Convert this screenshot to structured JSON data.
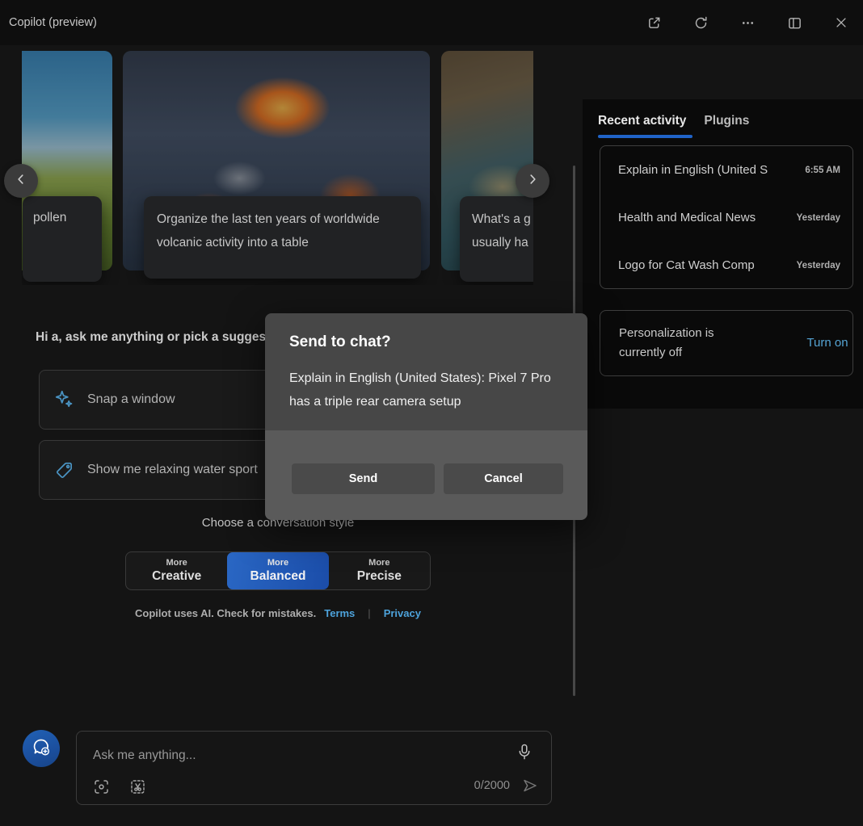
{
  "titlebar": {
    "title": "Copilot (preview)"
  },
  "carousel": {
    "cards": [
      {
        "label": "pollen"
      },
      {
        "label": "Organize the last ten years of worldwide volcanic activity into a table"
      },
      {
        "label_line1": "What's a g",
        "label_line2": "usually ha"
      }
    ]
  },
  "chat": {
    "greeting": "Hi a, ask me anything or pick a suggestion",
    "suggestions": [
      {
        "label": "Snap a window",
        "icon": "sparkle-icon"
      },
      {
        "label": "Show me relaxing water sport",
        "icon": "tag-icon"
      }
    ],
    "style_picker": {
      "caption": "Choose a conversation style",
      "options": [
        {
          "top": "More",
          "bottom": "Creative"
        },
        {
          "top": "More",
          "bottom": "Balanced"
        },
        {
          "top": "More",
          "bottom": "Precise"
        }
      ],
      "selected": "Balanced"
    },
    "disclaimer": {
      "text": "Copilot uses AI. Check for mistakes.",
      "terms_link": "Terms",
      "privacy_link": "Privacy"
    }
  },
  "dialog": {
    "title": "Send to chat?",
    "body": "Explain in English (United States): Pixel 7 Pro has a triple rear camera setup",
    "send_label": "Send",
    "cancel_label": "Cancel"
  },
  "right_panel": {
    "tabs": [
      {
        "label": "Recent activity",
        "active": true
      },
      {
        "label": "Plugins",
        "active": false
      }
    ],
    "recent_items": [
      {
        "title": "Explain in English (United S",
        "time": "6:55 AM"
      },
      {
        "title": "Health and Medical News",
        "time": "Yesterday"
      },
      {
        "title": "Logo for Cat Wash Comp",
        "time": "Yesterday"
      }
    ],
    "personalization": {
      "message": "Personalization is currently off",
      "action": "Turn on"
    }
  },
  "composer": {
    "placeholder": "Ask me anything...",
    "char_count": "0/2000"
  },
  "icons": [
    "open-external-icon",
    "refresh-icon",
    "more-icon",
    "side-panel-icon",
    "close-icon",
    "chevron-left-icon",
    "chevron-right-icon",
    "sparkle-icon",
    "tag-icon",
    "new-topic-chat-plus-icon",
    "mic-icon",
    "screenshot-icon",
    "snip-icon",
    "send-icon"
  ],
  "colors": {
    "accent_blue": "#2063c8",
    "link_blue": "#4da3dc",
    "selected_style_blue": "#1b4da9",
    "fab_blue": "#1d55a5",
    "panel_bg": "#0a0a0a",
    "dialog_bg": "#474747"
  }
}
